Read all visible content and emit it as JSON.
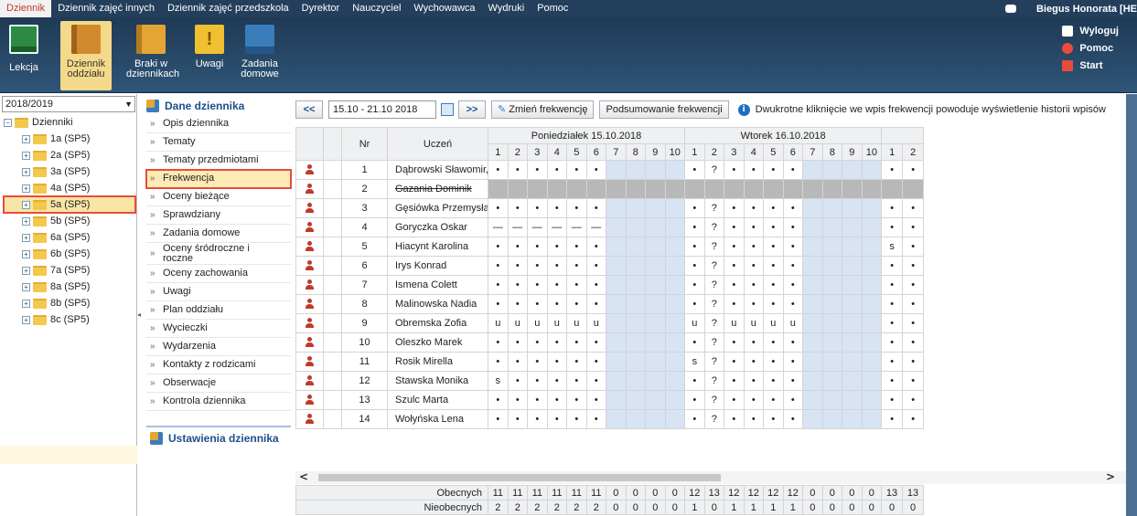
{
  "menu": {
    "items": [
      "Dziennik",
      "Dziennik zajęć innych",
      "Dziennik zajęć przedszkola",
      "Dyrektor",
      "Nauczyciel",
      "Wychowawca",
      "Wydruki",
      "Pomoc"
    ],
    "active": 0,
    "user": "Biegus Honorata [HE"
  },
  "toolbar": {
    "lekcja": "Lekcja",
    "dziennik1": "Dziennik",
    "dziennik2": "oddziału",
    "braki1": "Braki w",
    "braki2": "dziennikach",
    "uwagi": "Uwagi",
    "zadania1": "Zadania",
    "zadania2": "domowe",
    "wyloguj": "Wyloguj",
    "pomoc": "Pomoc",
    "start": "Start"
  },
  "sidebar": {
    "year": "2018/2019",
    "root": "Dzienniki",
    "classes": [
      "1a (SP5)",
      "2a (SP5)",
      "3a (SP5)",
      "4a (SP5)",
      "5a (SP5)",
      "5b (SP5)",
      "6a (SP5)",
      "6b (SP5)",
      "7a (SP5)",
      "8a (SP5)",
      "8b (SP5)",
      "8c (SP5)"
    ],
    "selected": 4
  },
  "nav": {
    "header": "Dane dziennika",
    "items": [
      "Opis dziennika",
      "Tematy",
      "Tematy przedmiotami",
      "Frekwencja",
      "Oceny bieżące",
      "Sprawdziany",
      "Zadania domowe",
      "Oceny śródroczne i roczne",
      "Oceny zachowania",
      "Uwagi",
      "Plan oddziału",
      "Wycieczki",
      "Wydarzenia",
      "Kontakty z rodzicami",
      "Obserwacje",
      "Kontrola dziennika"
    ],
    "selected": 3,
    "settings": "Ustawienia dziennika"
  },
  "controls": {
    "prev": "<<",
    "range": "15.10 - 21.10 2018",
    "next": ">>",
    "zmien": "Zmień frekwencję",
    "podsumowanie": "Podsumowanie frekwencji",
    "info": "Dwukrotne kliknięcie we wpis frekwencji powoduje wyświetlenie historii wpisów"
  },
  "grid": {
    "col_nr": "Nr",
    "col_uczen": "Uczeń",
    "days": [
      "Poniedziałek 15.10.2018",
      "Wtorek 16.10.2018"
    ],
    "periods": [
      "1",
      "2",
      "3",
      "4",
      "5",
      "6",
      "7",
      "8",
      "9",
      "10"
    ],
    "extra_periods": [
      "1",
      "2"
    ],
    "students": [
      {
        "nr": "1",
        "name": "Dąbrowski Sławomir, Tomasz",
        "d1": [
          "•",
          "•",
          "•",
          "•",
          "•",
          "•",
          "",
          "",
          "",
          ""
        ],
        "d2": [
          "•",
          "?",
          "•",
          "•",
          "•",
          "•",
          "",
          "",
          "",
          ""
        ],
        "d3": [
          "•",
          "•"
        ]
      },
      {
        "nr": "2",
        "name": "Gazania Dominik",
        "struck": true,
        "d1": [
          "",
          "",
          "",
          "",
          "",
          "",
          "",
          "",
          "",
          ""
        ],
        "d2": [
          "",
          "",
          "",
          "",
          "",
          "",
          "",
          "",
          "",
          ""
        ],
        "d3": [
          "",
          ""
        ]
      },
      {
        "nr": "3",
        "name": "Gęsiówka Przemysław",
        "d1": [
          "•",
          "•",
          "•",
          "•",
          "•",
          "•",
          "",
          "",
          "",
          ""
        ],
        "d2": [
          "•",
          "?",
          "•",
          "•",
          "•",
          "•",
          "",
          "",
          "",
          ""
        ],
        "d3": [
          "•",
          "•"
        ]
      },
      {
        "nr": "4",
        "name": "Goryczka Oskar",
        "d1": [
          "—",
          "—",
          "—",
          "—",
          "—",
          "—",
          "",
          "",
          "",
          ""
        ],
        "d2": [
          "•",
          "?",
          "•",
          "•",
          "•",
          "•",
          "",
          "",
          "",
          ""
        ],
        "d3": [
          "•",
          "•"
        ]
      },
      {
        "nr": "5",
        "name": "Hiacynt Karolina",
        "d1": [
          "•",
          "•",
          "•",
          "•",
          "•",
          "•",
          "",
          "",
          "",
          ""
        ],
        "d2": [
          "•",
          "?",
          "•",
          "•",
          "•",
          "•",
          "",
          "",
          "",
          ""
        ],
        "d3": [
          "s",
          "•"
        ]
      },
      {
        "nr": "6",
        "name": "Irys Konrad",
        "d1": [
          "•",
          "•",
          "•",
          "•",
          "•",
          "•",
          "",
          "",
          "",
          ""
        ],
        "d2": [
          "•",
          "?",
          "•",
          "•",
          "•",
          "•",
          "",
          "",
          "",
          ""
        ],
        "d3": [
          "•",
          "•"
        ]
      },
      {
        "nr": "7",
        "name": "Ismena Colett",
        "d1": [
          "•",
          "•",
          "•",
          "•",
          "•",
          "•",
          "",
          "",
          "",
          ""
        ],
        "d2": [
          "•",
          "?",
          "•",
          "•",
          "•",
          "•",
          "",
          "",
          "",
          ""
        ],
        "d3": [
          "•",
          "•"
        ]
      },
      {
        "nr": "8",
        "name": "Malinowska Nadia",
        "d1": [
          "•",
          "•",
          "•",
          "•",
          "•",
          "•",
          "",
          "",
          "",
          ""
        ],
        "d2": [
          "•",
          "?",
          "•",
          "•",
          "•",
          "•",
          "",
          "",
          "",
          ""
        ],
        "d3": [
          "•",
          "•"
        ]
      },
      {
        "nr": "9",
        "name": "Obremska Zofia",
        "d1": [
          "u",
          "u",
          "u",
          "u",
          "u",
          "u",
          "",
          "",
          "",
          ""
        ],
        "d2": [
          "u",
          "?",
          "u",
          "u",
          "u",
          "u",
          "",
          "",
          "",
          ""
        ],
        "d3": [
          "•",
          "•"
        ]
      },
      {
        "nr": "10",
        "name": "Oleszko Marek",
        "d1": [
          "•",
          "•",
          "•",
          "•",
          "•",
          "•",
          "",
          "",
          "",
          ""
        ],
        "d2": [
          "•",
          "?",
          "•",
          "•",
          "•",
          "•",
          "",
          "",
          "",
          ""
        ],
        "d3": [
          "•",
          "•"
        ]
      },
      {
        "nr": "11",
        "name": "Rosik Mirella",
        "d1": [
          "•",
          "•",
          "•",
          "•",
          "•",
          "•",
          "",
          "",
          "",
          ""
        ],
        "d2": [
          "s",
          "?",
          "•",
          "•",
          "•",
          "•",
          "",
          "",
          "",
          ""
        ],
        "d3": [
          "•",
          "•"
        ]
      },
      {
        "nr": "12",
        "name": "Stawska Monika",
        "d1": [
          "s",
          "•",
          "•",
          "•",
          "•",
          "•",
          "",
          "",
          "",
          ""
        ],
        "d2": [
          "•",
          "?",
          "•",
          "•",
          "•",
          "•",
          "",
          "",
          "",
          ""
        ],
        "d3": [
          "•",
          "•"
        ]
      },
      {
        "nr": "13",
        "name": "Szulc Marta",
        "d1": [
          "•",
          "•",
          "•",
          "•",
          "•",
          "•",
          "",
          "",
          "",
          ""
        ],
        "d2": [
          "•",
          "?",
          "•",
          "•",
          "•",
          "•",
          "",
          "",
          "",
          ""
        ],
        "d3": [
          "•",
          "•"
        ]
      },
      {
        "nr": "14",
        "name": "Wołyńska Lena",
        "d1": [
          "•",
          "•",
          "•",
          "•",
          "•",
          "•",
          "",
          "",
          "",
          ""
        ],
        "d2": [
          "•",
          "?",
          "•",
          "•",
          "•",
          "•",
          "",
          "",
          "",
          ""
        ],
        "d3": [
          "•",
          "•"
        ]
      }
    ]
  },
  "totals": {
    "obecnych_label": "Obecnych",
    "obecnych": [
      "11",
      "11",
      "11",
      "11",
      "11",
      "11",
      "0",
      "0",
      "0",
      "0",
      "12",
      "13",
      "12",
      "12",
      "12",
      "12",
      "0",
      "0",
      "0",
      "0",
      "13",
      "13"
    ],
    "nieobecnych_label": "Nieobecnych",
    "nieobecnych": [
      "2",
      "2",
      "2",
      "2",
      "2",
      "2",
      "0",
      "0",
      "0",
      "0",
      "1",
      "0",
      "1",
      "1",
      "1",
      "1",
      "0",
      "0",
      "0",
      "0",
      "0",
      "0"
    ]
  },
  "scroll": {
    "left": "<",
    "right": ">"
  }
}
